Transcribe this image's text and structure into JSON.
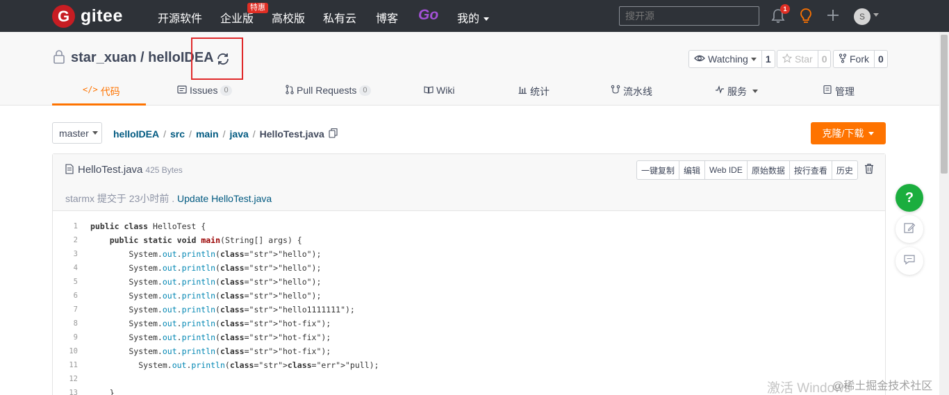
{
  "brand": {
    "name": "gitee",
    "logo_letter": "G"
  },
  "nav": {
    "items": [
      "开源软件",
      "企业版",
      "高校版",
      "私有云",
      "博客"
    ],
    "badge": "特惠",
    "go": "Go",
    "mine": "我的",
    "search_placeholder": "搜开源",
    "notification_count": "1",
    "avatar_letter": "S"
  },
  "repo": {
    "title": "star_xuan / helloIDEA",
    "watch_label": "Watching",
    "watch_count": "1",
    "star_label": "Star",
    "star_count": "0",
    "fork_label": "Fork",
    "fork_count": "0"
  },
  "tabs": [
    {
      "label": "代码",
      "icon": "code-icon"
    },
    {
      "label": "Issues",
      "count": "0",
      "icon": "issues-icon"
    },
    {
      "label": "Pull Requests",
      "count": "0",
      "icon": "pull-request-icon"
    },
    {
      "label": "Wiki",
      "icon": "wiki-icon"
    },
    {
      "label": "统计",
      "icon": "stats-icon"
    },
    {
      "label": "流水线",
      "icon": "pipeline-icon"
    },
    {
      "label": "服务",
      "icon": "service-icon"
    },
    {
      "label": "管理",
      "icon": "manage-icon"
    }
  ],
  "branch": "master",
  "breadcrumb": [
    "helloIDEA",
    "src",
    "main",
    "java",
    "HelloTest.java"
  ],
  "clone_label": "克隆/下载",
  "file": {
    "name": "HelloTest.java",
    "size": "425 Bytes",
    "commit_prefix": "starmx 提交于 23小时前 . ",
    "commit_message": "Update HelloTest.java",
    "actions": [
      "一键复制",
      "编辑",
      "Web IDE",
      "原始数据",
      "按行查看",
      "历史"
    ]
  },
  "code_lines": [
    {
      "n": "1",
      "t": "public class HelloTest {"
    },
    {
      "n": "2",
      "t": "    public static void main(String[] args) {"
    },
    {
      "n": "3",
      "t": "        System.out.println(\"hello\");"
    },
    {
      "n": "4",
      "t": "        System.out.println(\"hello\");"
    },
    {
      "n": "5",
      "t": "        System.out.println(\"hello\");"
    },
    {
      "n": "6",
      "t": "        System.out.println(\"hello\");"
    },
    {
      "n": "7",
      "t": "        System.out.println(\"hello1111111\");"
    },
    {
      "n": "8",
      "t": "        System.out.println(\"hot-fix\");"
    },
    {
      "n": "9",
      "t": "        System.out.println(\"hot-fix\");"
    },
    {
      "n": "10",
      "t": "        System.out.println(\"hot-fix\");"
    },
    {
      "n": "11",
      "t": "          System.out.println(\"pull);"
    },
    {
      "n": "12",
      "t": ""
    },
    {
      "n": "13",
      "t": "    }"
    }
  ],
  "float_help": "?",
  "watermark": "激活 Windows",
  "watermark2": "@稀土掘金技术社区"
}
